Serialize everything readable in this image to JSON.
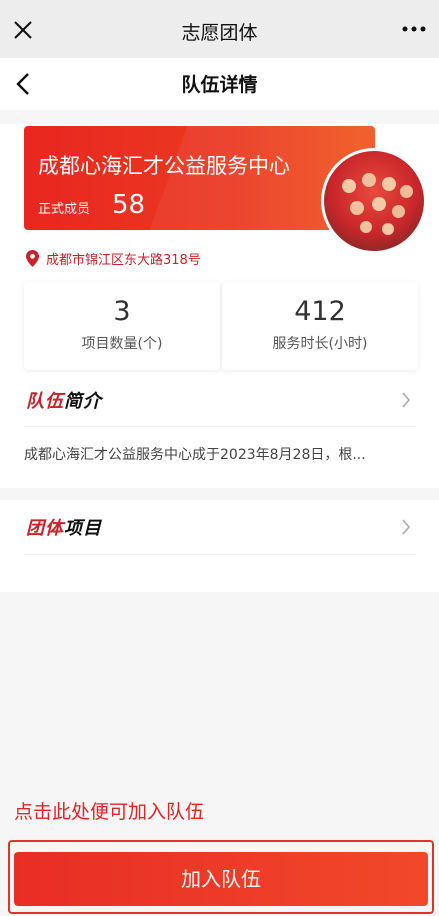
{
  "window": {
    "title": "志愿团体",
    "close_icon": "close-icon",
    "more_icon": "more-icon"
  },
  "nav": {
    "title": "队伍详情",
    "back_icon": "back-arrow-icon"
  },
  "team": {
    "name": "成都心海汇才公益服务中心",
    "member_label": "正式成员",
    "member_count": "58",
    "address": "成都市锦江区东大路318号",
    "address_icon": "location-pin-icon"
  },
  "stats": [
    {
      "value": "3",
      "label": "项目数量(个)"
    },
    {
      "value": "412",
      "label": "服务时长(小时)"
    }
  ],
  "intro": {
    "title_red": "队伍",
    "title_black": "简介",
    "text": "成都心海汇才公益服务中心成于2023年8月28日，根..."
  },
  "projects": {
    "title_red": "团体",
    "title_black": "项目"
  },
  "footer": {
    "hint": "点击此处便可加入队伍",
    "join_label": "加入队伍"
  },
  "colors": {
    "accent_red": "#e8291f",
    "text_red": "#c8232b"
  }
}
